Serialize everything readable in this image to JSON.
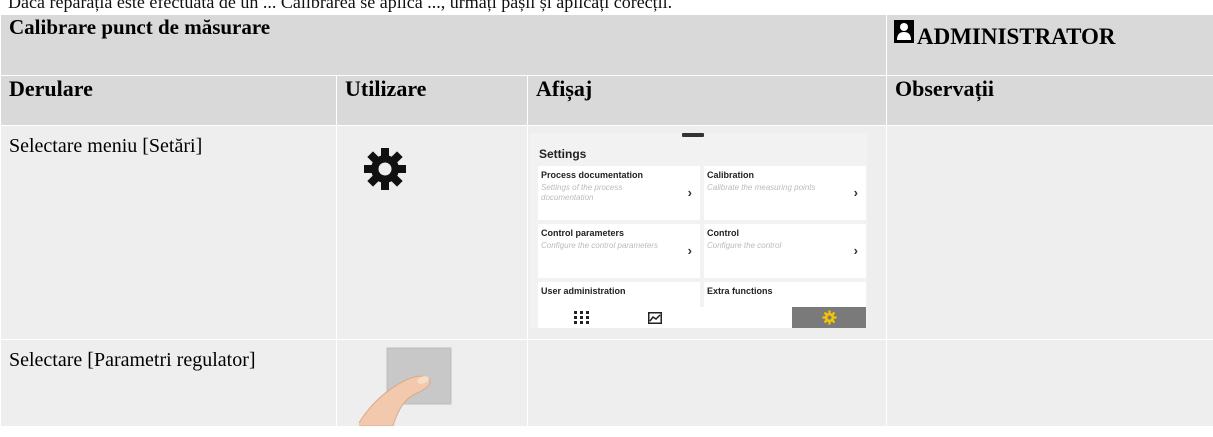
{
  "top_text": "Dacă reparația este efectuată de un ... Calibrarea se aplică ..., urmați pașii și aplicați corecții.",
  "title": "Calibrare punct de măsurare",
  "role": {
    "label": "ADMINISTRATOR",
    "icon": "user-icon"
  },
  "columns": [
    "Derulare",
    "Utilizare",
    "Afișaj",
    "Observații"
  ],
  "rows": [
    {
      "step": "Selectare meniu [Setări]",
      "usage_icon": "gear-icon",
      "display": "settings-screen",
      "notes": ""
    },
    {
      "step": "Selectare [Parametri regulator]",
      "usage_icon": "finger-tap-icon",
      "display": "",
      "notes": ""
    }
  ],
  "settings_screen": {
    "title": "Settings",
    "tiles": [
      {
        "name": "Process documentation",
        "desc": "Settings of the process documentation"
      },
      {
        "name": "Calibration",
        "desc": "Calibrate the measuring points"
      },
      {
        "name": "Control parameters",
        "desc": "Configure the control parameters"
      },
      {
        "name": "Control",
        "desc": "Configure the control"
      },
      {
        "name": "User administration",
        "desc": ""
      },
      {
        "name": "Extra functions",
        "desc": ""
      }
    ],
    "bottom_bar": [
      "grid-menu-icon",
      "chart-icon",
      "gear-icon"
    ],
    "active_item": "gear-icon",
    "accent": "#f5c400",
    "active_bg": "#7a7a7a"
  }
}
